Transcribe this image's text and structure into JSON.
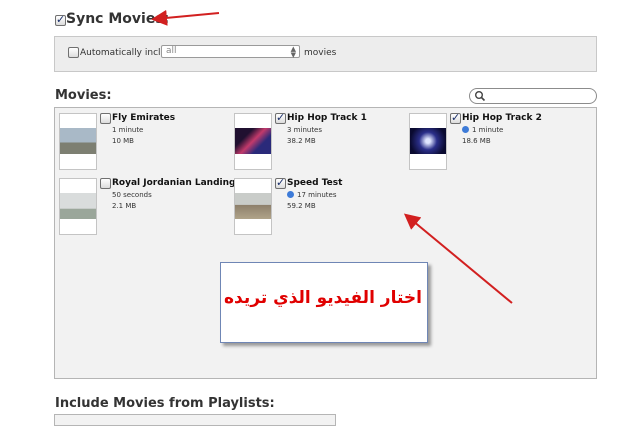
{
  "sync": {
    "label": "Sync Movies:",
    "checked": true
  },
  "auto_include": {
    "label": "Automatically include",
    "checked": false,
    "select_value": "all",
    "suffix": "movies"
  },
  "movies_section": {
    "title": "Movies:"
  },
  "movies": [
    {
      "title": "Fly Emirates",
      "duration": "1 minute",
      "size": "10 MB",
      "checked": false,
      "partial": false
    },
    {
      "title": "Hip Hop Track 1",
      "duration": "3 minutes",
      "size": "38.2 MB",
      "checked": true,
      "partial": false
    },
    {
      "title": "Hip Hop Track 2",
      "duration": "1 minute",
      "size": "18.6 MB",
      "checked": true,
      "partial": true
    },
    {
      "title": "Royal Jordanian Landing",
      "duration": "50 seconds",
      "size": "2.1 MB",
      "checked": false,
      "partial": false
    },
    {
      "title": "Speed Test",
      "duration": "17 minutes",
      "size": "59.2 MB",
      "checked": true,
      "partial": true
    }
  ],
  "annotation": {
    "text": "اختار الفيديو الذي تريده",
    "color": "#e00000"
  },
  "playlists_section": {
    "title": "Include Movies from Playlists:"
  },
  "colors": {
    "accent_arrow": "#d22020",
    "panel_bg": "#f2f2f2",
    "info_icon": "#3d7bd8"
  }
}
